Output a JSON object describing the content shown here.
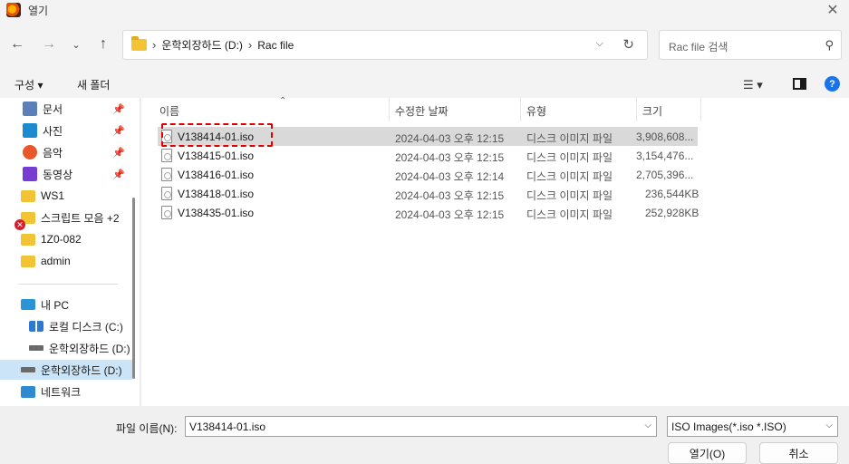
{
  "window": {
    "title": "열기",
    "app_icon": "app-icon",
    "close_icon": "close-icon"
  },
  "nav": {
    "back_icon": "arrow-left-icon",
    "forward_icon": "arrow-right-icon",
    "recent_icon": "chevron-down-icon",
    "up_icon": "arrow-up-icon",
    "breadcrumb": [
      "운학외장하드 (D:)",
      "Rac file"
    ],
    "refresh_icon": "refresh-icon",
    "search_placeholder": "Rac file 검색"
  },
  "toolbar": {
    "organize_label": "구성",
    "new_folder_label": "새 폴더"
  },
  "sidebar": {
    "items": [
      {
        "label": "문서",
        "icon": "document-icon",
        "pinned": true
      },
      {
        "label": "사진",
        "icon": "pictures-icon",
        "pinned": true
      },
      {
        "label": "음악",
        "icon": "music-icon",
        "pinned": true
      },
      {
        "label": "동영상",
        "icon": "video-icon",
        "pinned": true
      },
      {
        "label": "WS1",
        "icon": "folder-icon"
      },
      {
        "label": "스크립트 모음 +2",
        "icon": "folder-icon",
        "error": true
      },
      {
        "label": "1Z0-082",
        "icon": "folder-icon"
      },
      {
        "label": "admin",
        "icon": "folder-icon"
      },
      {
        "label": "내 PC",
        "icon": "pc-icon"
      },
      {
        "label": "로컬 디스크 (C:)",
        "icon": "windows-drive-icon"
      },
      {
        "label": "운학외장하드 (D:)",
        "icon": "drive-icon"
      },
      {
        "label": "운학외장하드 (D:)",
        "icon": "drive-icon",
        "selected": true
      },
      {
        "label": "네트워크",
        "icon": "network-icon"
      }
    ]
  },
  "file_list": {
    "columns": [
      "이름",
      "수정한 날짜",
      "유형",
      "크기"
    ],
    "rows": [
      {
        "name": "V138414-01.iso",
        "modified": "2024-04-03 오후 12:15",
        "type": "디스크 이미지 파일",
        "size": "3,908,608...",
        "selected": true
      },
      {
        "name": "V138415-01.iso",
        "modified": "2024-04-03 오후 12:15",
        "type": "디스크 이미지 파일",
        "size": "3,154,476..."
      },
      {
        "name": "V138416-01.iso",
        "modified": "2024-04-03 오후 12:14",
        "type": "디스크 이미지 파일",
        "size": "2,705,396..."
      },
      {
        "name": "V138418-01.iso",
        "modified": "2024-04-03 오후 12:15",
        "type": "디스크 이미지 파일",
        "size": "236,544KB"
      },
      {
        "name": "V138435-01.iso",
        "modified": "2024-04-03 오후 12:15",
        "type": "디스크 이미지 파일",
        "size": "252,928KB"
      }
    ]
  },
  "footer": {
    "filename_label": "파일 이름(N):",
    "filename_value": "V138414-01.iso",
    "filetype_value": "ISO Images(*.iso *.ISO)",
    "open_label": "열기(O)",
    "cancel_label": "취소"
  },
  "colors": {
    "accent": "#1a73e8",
    "selection": "#cce4f7",
    "highlight": "#e00000"
  }
}
